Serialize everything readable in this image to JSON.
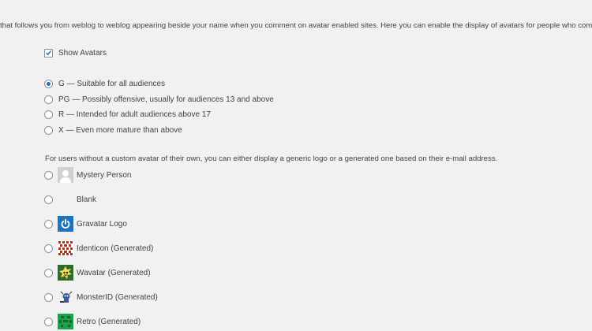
{
  "intro_text": "that follows you from weblog to weblog appearing beside your name when you comment on avatar enabled sites. Here you can enable the display of avatars for people who comment o",
  "show_avatars": {
    "label": "Show Avatars",
    "checked": true
  },
  "ratings": [
    {
      "label": "G — Suitable for all audiences",
      "selected": true
    },
    {
      "label": "PG — Possibly offensive, usually for audiences 13 and above",
      "selected": false
    },
    {
      "label": "R — Intended for adult audiences above 17",
      "selected": false
    },
    {
      "label": "X — Even more mature than above",
      "selected": false
    }
  ],
  "default_avatar_description": "For users without a custom avatar of their own, you can either display a generic logo or a generated one based on their e-mail address.",
  "default_avatars": [
    {
      "label": "Mystery Person",
      "icon": "mystery-person-icon"
    },
    {
      "label": "Blank",
      "icon": "blank-icon"
    },
    {
      "label": "Gravatar Logo",
      "icon": "gravatar-logo-icon"
    },
    {
      "label": "Identicon (Generated)",
      "icon": "identicon-icon"
    },
    {
      "label": "Wavatar (Generated)",
      "icon": "wavatar-icon"
    },
    {
      "label": "MonsterID (Generated)",
      "icon": "monsterid-icon"
    },
    {
      "label": "Retro (Generated)",
      "icon": "retro-icon"
    }
  ],
  "colors": {
    "accent": "#2271b1",
    "gravatar_blue": "#1e73be",
    "wavatar_green": "#2f6b2f",
    "retro_green": "#1aa34a"
  }
}
